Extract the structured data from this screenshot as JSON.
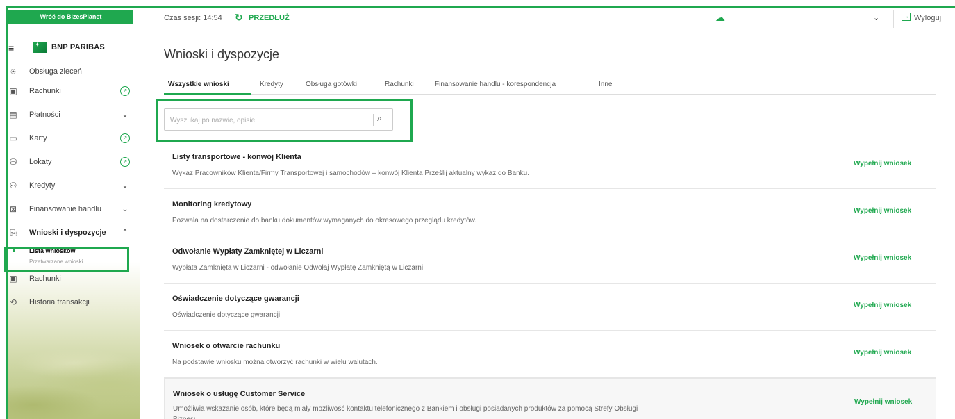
{
  "sidebar": {
    "back_label": "Wróć do BizesPlanet",
    "logo_text": "BNP PARIBAS",
    "items": [
      {
        "label": "Obsługa zleceń",
        "icon": "antenna-icon",
        "trail": ""
      },
      {
        "label": "Rachunki",
        "icon": "accounts-icon",
        "trail": "circle"
      },
      {
        "label": "Płatności",
        "icon": "payments-icon",
        "trail": "chevron"
      },
      {
        "label": "Karty",
        "icon": "card-icon",
        "trail": "circle"
      },
      {
        "label": "Lokaty",
        "icon": "deposit-icon",
        "trail": "circle"
      },
      {
        "label": "Kredyty",
        "icon": "credit-icon",
        "trail": "chevron"
      },
      {
        "label": "Finansowanie handlu",
        "icon": "trade-finance-icon",
        "trail": "chevron"
      },
      {
        "label": "Wnioski i dyspozycje",
        "icon": "applications-icon",
        "trail": "chevron-up"
      }
    ],
    "sub_items": [
      {
        "label": "Lista wniosków"
      },
      {
        "label": "Przetwarzane wnioski"
      }
    ],
    "items_after": [
      {
        "label": "Rachunki",
        "icon": "accounts-icon"
      },
      {
        "label": "Historia transakcji",
        "icon": "history-icon"
      }
    ]
  },
  "topbar": {
    "session_label": "Czas sesji: 14:54",
    "extend_label": "PRZEDŁUŻ",
    "logout_label": "Wyloguj"
  },
  "main": {
    "title": "Wnioski i dyspozycje",
    "tabs": [
      {
        "label": "Wszystkie wnioski",
        "active": true
      },
      {
        "label": "Kredyty"
      },
      {
        "label": "Obsługa gotówki"
      },
      {
        "label": "Rachunki"
      },
      {
        "label": "Finansowanie handlu - korespondencja"
      },
      {
        "label": "Inne"
      }
    ],
    "search": {
      "placeholder": "Wyszukaj po nazwie, opisie",
      "value": ""
    },
    "rows": [
      {
        "title": "Listy transportowe - konwój Klienta",
        "desc": "Wykaz Pracowników Klienta/Firmy Transportowej i samochodów – konwój Klienta Prześlij aktualny wykaz do Banku.",
        "action": "Wypełnij wniosek"
      },
      {
        "title": "Monitoring kredytowy",
        "desc": "Pozwala na dostarczenie do banku dokumentów wymaganych do okresowego przeglądu kredytów.",
        "action": "Wypełnij wniosek"
      },
      {
        "title": "Odwołanie Wypłaty Zamkniętej w Liczarni",
        "desc": "Wypłata Zamknięta w Liczarni - odwołanie Odwołaj Wypłatę Zamkniętą w Liczarni.",
        "action": "Wypełnij wniosek"
      },
      {
        "title": "Oświadczenie dotyczące gwarancji",
        "desc": "Oświadczenie dotyczące gwarancji",
        "action": "Wypełnij wniosek"
      },
      {
        "title": "Wniosek o otwarcie rachunku",
        "desc": "Na podstawie wniosku można otworzyć rachunki w wielu walutach.",
        "action": "Wypełnij wniosek"
      },
      {
        "title": "Wniosek o usługę Customer Service",
        "desc": "Umożliwia wskazanie osób, które będą miały możliwość kontaktu telefonicznego z Bankiem i obsługi posiadanych produktów za pomocą Strefy Obsługi Biznesu.",
        "action": "Wypełnij wniosek"
      }
    ]
  },
  "colors": {
    "accent": "#1fa84f"
  }
}
